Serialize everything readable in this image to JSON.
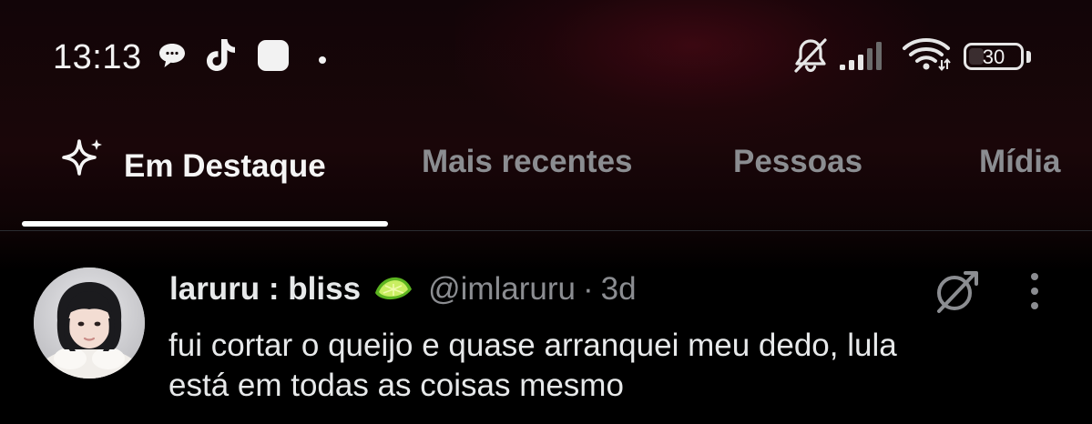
{
  "status_bar": {
    "time": "13:13",
    "battery_level": "30",
    "battery_fraction": 0.3,
    "left_icons": [
      "chat-bubble-icon",
      "tiktok-icon",
      "app-square-icon",
      "notification-dot-icon"
    ],
    "right_icons": [
      "bell-muted-icon",
      "signal-icon",
      "wifi-icon",
      "battery-icon"
    ]
  },
  "tabs": [
    {
      "label": "Em Destaque",
      "icon": "sparkle-icon",
      "active": true
    },
    {
      "label": "Mais recentes",
      "active": false
    },
    {
      "label": "Pessoas",
      "active": false
    },
    {
      "label": "Mídia",
      "active": false
    }
  ],
  "tweet": {
    "display_name": "laruru : bliss",
    "name_emoji": "lime-icon",
    "handle": "@imlaruru",
    "separator": "·",
    "age": "3d",
    "text_lines": [
      "fui cortar o queijo e quase arranquei meu dedo, lula",
      "está em todas as coisas mesmo"
    ],
    "actions": [
      "grok-icon",
      "more-options-icon"
    ]
  },
  "colors": {
    "background": "#000000",
    "header_gradient": "#1a0609",
    "text_primary": "#e7e9ea",
    "text_secondary": "#8b8d91",
    "tab_indicator": "#ffffff",
    "divider": "#2a2d31"
  }
}
